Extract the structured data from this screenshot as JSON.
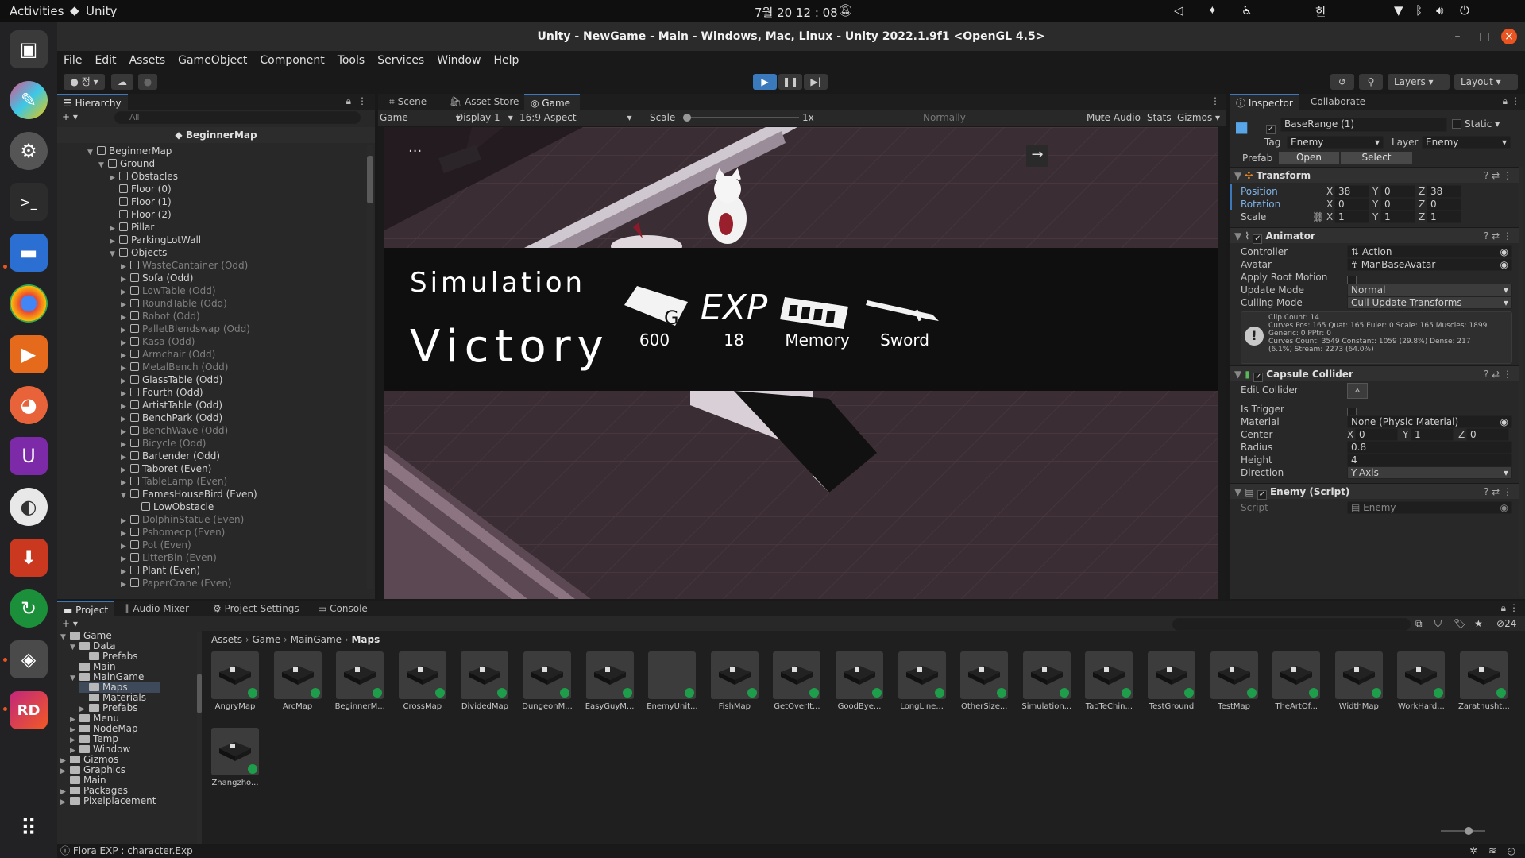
{
  "os": {
    "activities": "Activities",
    "app": "Unity",
    "clock": "7월 20  12 : 08",
    "ime": "한"
  },
  "window": {
    "title": "Unity - NewGame - Main - Windows, Mac, Linux - Unity 2022.1.9f1 <OpenGL 4.5>"
  },
  "menu": [
    "File",
    "Edit",
    "Assets",
    "GameObject",
    "Component",
    "Tools",
    "Services",
    "Window",
    "Help"
  ],
  "toolbar": {
    "account": "정",
    "layers": "Layers",
    "layout": "Layout"
  },
  "hierarchy": {
    "tab": "Hierarchy",
    "search_placeholder": "All",
    "scene": "BeginnerMap",
    "rows": [
      {
        "t": "BeginnerMap",
        "d": 0,
        "a": "▼",
        "dim": false
      },
      {
        "t": "Ground",
        "d": 1,
        "a": "▼",
        "dim": false
      },
      {
        "t": "Obstacles",
        "d": 2,
        "a": "▶",
        "dim": false
      },
      {
        "t": "Floor (0)",
        "d": 2,
        "a": "",
        "dim": false
      },
      {
        "t": "Floor (1)",
        "d": 2,
        "a": "",
        "dim": false
      },
      {
        "t": "Floor (2)",
        "d": 2,
        "a": "",
        "dim": false
      },
      {
        "t": "Pillar",
        "d": 2,
        "a": "▶",
        "dim": false
      },
      {
        "t": "ParkingLotWall",
        "d": 2,
        "a": "▶",
        "dim": false
      },
      {
        "t": "Objects",
        "d": 2,
        "a": "▼",
        "dim": false
      },
      {
        "t": "WasteCantainer (Odd)",
        "d": 3,
        "a": "▶",
        "dim": true
      },
      {
        "t": "Sofa (Odd)",
        "d": 3,
        "a": "▶",
        "dim": false
      },
      {
        "t": "LowTable (Odd)",
        "d": 3,
        "a": "▶",
        "dim": true
      },
      {
        "t": "RoundTable (Odd)",
        "d": 3,
        "a": "▶",
        "dim": true
      },
      {
        "t": "Robot (Odd)",
        "d": 3,
        "a": "▶",
        "dim": true
      },
      {
        "t": "PalletBlendswap (Odd)",
        "d": 3,
        "a": "▶",
        "dim": true
      },
      {
        "t": "Kasa (Odd)",
        "d": 3,
        "a": "▶",
        "dim": true
      },
      {
        "t": "Armchair (Odd)",
        "d": 3,
        "a": "▶",
        "dim": true
      },
      {
        "t": "MetalBench (Odd)",
        "d": 3,
        "a": "▶",
        "dim": true
      },
      {
        "t": "GlassTable (Odd)",
        "d": 3,
        "a": "▶",
        "dim": false
      },
      {
        "t": "Fourth (Odd)",
        "d": 3,
        "a": "▶",
        "dim": false
      },
      {
        "t": "ArtistTable (Odd)",
        "d": 3,
        "a": "▶",
        "dim": false
      },
      {
        "t": "BenchPark (Odd)",
        "d": 3,
        "a": "▶",
        "dim": false
      },
      {
        "t": "BenchWave (Odd)",
        "d": 3,
        "a": "▶",
        "dim": true
      },
      {
        "t": "Bicycle (Odd)",
        "d": 3,
        "a": "▶",
        "dim": true
      },
      {
        "t": "Bartender (Odd)",
        "d": 3,
        "a": "▶",
        "dim": false
      },
      {
        "t": "Taboret (Even)",
        "d": 3,
        "a": "▶",
        "dim": false
      },
      {
        "t": "TableLamp (Even)",
        "d": 3,
        "a": "▶",
        "dim": true
      },
      {
        "t": "EamesHouseBird (Even)",
        "d": 3,
        "a": "▼",
        "dim": false
      },
      {
        "t": "LowObstacle",
        "d": 4,
        "a": "",
        "dim": false
      },
      {
        "t": "DolphinStatue (Even)",
        "d": 3,
        "a": "▶",
        "dim": true
      },
      {
        "t": "Pshomecp (Even)",
        "d": 3,
        "a": "▶",
        "dim": true
      },
      {
        "t": "Pot (Even)",
        "d": 3,
        "a": "▶",
        "dim": true
      },
      {
        "t": "LitterBin (Even)",
        "d": 3,
        "a": "▶",
        "dim": true
      },
      {
        "t": "Plant (Even)",
        "d": 3,
        "a": "▶",
        "dim": false
      },
      {
        "t": "PaperCrane (Even)",
        "d": 3,
        "a": "▶",
        "dim": true
      }
    ]
  },
  "game": {
    "tabs": [
      "Scene",
      "Asset Store",
      "Game"
    ],
    "mode": "Game",
    "display": "Display 1",
    "aspect": "16:9 Aspect",
    "scale_label": "Scale",
    "scale_value": "1x",
    "render": "Normally",
    "mute": "Mute Audio",
    "stats": "Stats",
    "gizmos": "Gizmos",
    "result": {
      "line1": "Simulation",
      "line2": "Victory",
      "rewards": [
        {
          "icon": "G",
          "label": "600"
        },
        {
          "icon": "EXP",
          "label": "18"
        },
        {
          "icon": "memory",
          "label": "Memory"
        },
        {
          "icon": "sword",
          "label": "Sword"
        }
      ]
    }
  },
  "inspector": {
    "tabs": [
      "Inspector",
      "Collaborate"
    ],
    "object": "BaseRange (1)",
    "static": "Static",
    "tag_label": "Tag",
    "tag": "Enemy",
    "layer_label": "Layer",
    "layer": "Enemy",
    "prefab": "Prefab",
    "open": "Open",
    "select": "Select",
    "transform": {
      "title": "Transform",
      "position": [
        "38",
        "0",
        "38"
      ],
      "rotation": [
        "0",
        "0",
        "0"
      ],
      "scale": [
        "1",
        "1",
        "1"
      ],
      "l_pos": "Position",
      "l_rot": "Rotation",
      "l_scale": "Scale"
    },
    "animator": {
      "title": "Animator",
      "controller_l": "Controller",
      "controller": "Action",
      "avatar_l": "Avatar",
      "avatar": "ManBaseAvatar",
      "root_l": "Apply Root Motion",
      "update_l": "Update Mode",
      "update": "Normal",
      "cull_l": "Culling Mode",
      "cull": "Cull Update Transforms",
      "info": [
        "Clip Count: 14",
        "Curves Pos: 165 Quat: 165 Euler: 0 Scale: 165 Muscles: 1899",
        "Generic: 0 PPtr: 0",
        "Curves Count: 3549 Constant: 1059 (29.8%) Dense: 217",
        "(6.1%) Stream: 2273 (64.0%)"
      ]
    },
    "collider": {
      "title": "Capsule Collider",
      "edit_l": "Edit Collider",
      "trigger_l": "Is Trigger",
      "material_l": "Material",
      "material": "None (Physic Material)",
      "center_l": "Center",
      "center": [
        "0",
        "1",
        "0"
      ],
      "radius_l": "Radius",
      "radius": "0.8",
      "height_l": "Height",
      "height": "4",
      "dir_l": "Direction",
      "dir": "Y-Axis"
    },
    "script": {
      "title": "Enemy (Script)",
      "script_l": "Script",
      "script": "Enemy"
    }
  },
  "project": {
    "tabs": [
      "Project",
      "Audio Mixer",
      "Project Settings",
      "Console"
    ],
    "count": "24",
    "breadcrumb": [
      "Assets",
      "Game",
      "MainGame",
      "Maps"
    ],
    "tree": [
      {
        "t": "Game",
        "d": 0,
        "a": "▼"
      },
      {
        "t": "Data",
        "d": 1,
        "a": "▼"
      },
      {
        "t": "Prefabs",
        "d": 2,
        "a": ""
      },
      {
        "t": "Main",
        "d": 1,
        "a": ""
      },
      {
        "t": "MainGame",
        "d": 1,
        "a": "▼"
      },
      {
        "t": "Maps",
        "d": 2,
        "a": "",
        "sel": true
      },
      {
        "t": "Materials",
        "d": 2,
        "a": ""
      },
      {
        "t": "Prefabs",
        "d": 2,
        "a": "▶"
      },
      {
        "t": "Menu",
        "d": 1,
        "a": "▶"
      },
      {
        "t": "NodeMap",
        "d": 1,
        "a": "▶"
      },
      {
        "t": "Temp",
        "d": 1,
        "a": "▶"
      },
      {
        "t": "Window",
        "d": 1,
        "a": "▶"
      },
      {
        "t": "Gizmos",
        "d": 0,
        "a": "▶"
      },
      {
        "t": "Graphics",
        "d": 0,
        "a": "▶"
      },
      {
        "t": "Main",
        "d": 0,
        "a": ""
      },
      {
        "t": "Packages",
        "d": 0,
        "a": "▶"
      },
      {
        "t": "Pixelplacement",
        "d": 0,
        "a": "▶"
      }
    ],
    "assets": [
      "AngryMap",
      "ArcMap",
      "BeginnerM...",
      "CrossMap",
      "DividedMap",
      "DungeonM...",
      "EasyGuyM...",
      "EnemyUnit...",
      "FishMap",
      "GetOverIt...",
      "GoodBye...",
      "LongLine...",
      "OtherSize...",
      "Simulation...",
      "TaoTeChin...",
      "TestGround",
      "TestMap",
      "TheArtOf...",
      "WidthMap",
      "WorkHard...",
      "Zarathusht...",
      "Zhangzho..."
    ]
  },
  "status": {
    "text": "Flora EXP : character.Exp"
  },
  "colors": {
    "accent": "#3a79bb",
    "victory_band": "#0f0f0f",
    "badge": "#1e9e4a"
  }
}
